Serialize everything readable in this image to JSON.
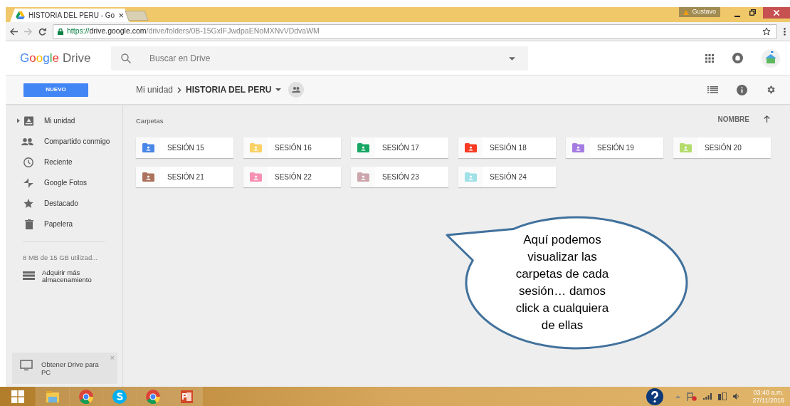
{
  "browser": {
    "tab_title": "HISTORIA DEL PERU - Go",
    "tab_close": "×",
    "user": "Gustavo",
    "url_scheme": "https://",
    "url_host": "drive.google.com",
    "url_path": "/drive/folders/0B-15GxIFJwdpaENoMXNvVDdvaWM"
  },
  "header": {
    "logo_letters": [
      {
        "text": "G",
        "color": "#4285f4"
      },
      {
        "text": "o",
        "color": "#ea4335"
      },
      {
        "text": "o",
        "color": "#fbbc05"
      },
      {
        "text": "g",
        "color": "#4285f4"
      },
      {
        "text": "l",
        "color": "#34a853"
      },
      {
        "text": "e",
        "color": "#ea4335"
      }
    ],
    "logo_product": "Drive",
    "search": {
      "placeholder": "Buscar en Drive"
    }
  },
  "toolbar": {
    "new_button": "NUEVO",
    "breadcrumb": [
      "Mi unidad",
      "HISTORIA DEL PERU"
    ]
  },
  "sidebar": {
    "items": [
      {
        "label": "Mi unidad"
      },
      {
        "label": "Compartido conmigo"
      },
      {
        "label": "Reciente"
      },
      {
        "label": "Google Fotos"
      },
      {
        "label": "Destacado"
      },
      {
        "label": "Papelera"
      }
    ],
    "storage": "8 MB de 15 GB utilizad...",
    "upgrade": "Adquirir más almacenamiento",
    "promo": {
      "text": "Obtener Drive para PC",
      "close": "×"
    }
  },
  "content": {
    "section": "Carpetas",
    "sort": "NOMBRE",
    "folders": [
      {
        "name": "SESIÓN 15",
        "color": "#4986e7"
      },
      {
        "name": "SESIÓN 16",
        "color": "#fad165"
      },
      {
        "name": "SESIÓN 17",
        "color": "#16a765"
      },
      {
        "name": "SESIÓN 18",
        "color": "#f83a22"
      },
      {
        "name": "SESIÓN 19",
        "color": "#a47ae2"
      },
      {
        "name": "SESIÓN 20",
        "color": "#b3dc6c"
      },
      {
        "name": "SESIÓN 21",
        "color": "#ac725e"
      },
      {
        "name": "SESIÓN 22",
        "color": "#f691b2"
      },
      {
        "name": "SESIÓN 23",
        "color": "#cca6ac"
      },
      {
        "name": "SESIÓN 24",
        "color": "#9fe1e7"
      }
    ]
  },
  "callout": {
    "text": "Aquí podemos\nvisualizar las\ncarpetas de cada\nsesión… damos\nclick a cualquiera\nde ellas"
  },
  "taskbar": {
    "time": "03:40 a.m.",
    "date": "27/11/2016"
  }
}
